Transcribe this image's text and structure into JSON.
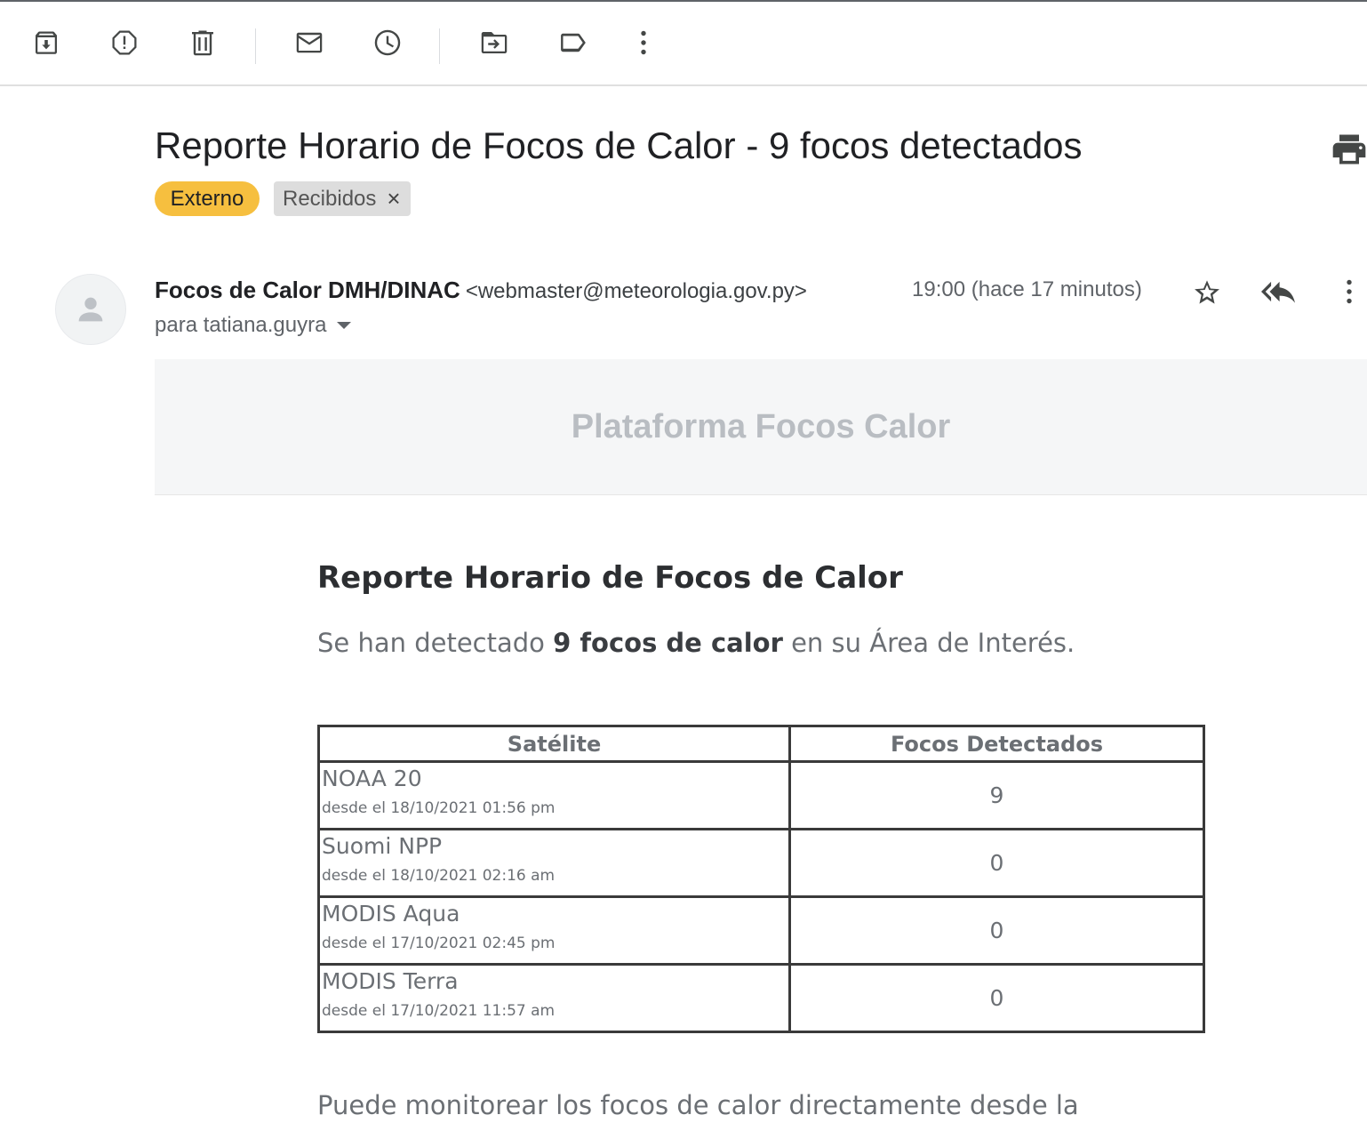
{
  "toolbar": {
    "icons": [
      "archive-icon",
      "report-spam-icon",
      "delete-icon",
      "mark-unread-icon",
      "snooze-icon",
      "move-to-icon",
      "label-icon",
      "more-vert-icon"
    ]
  },
  "subject": "Reporte Horario de Focos de Calor - 9 focos detectados",
  "labels": {
    "external": "Externo",
    "inbox": "Recibidos",
    "inbox_remove": "×"
  },
  "sender": {
    "name": "Focos de Calor DMH/DINAC",
    "email": "<webmaster@meteorologia.gov.py>",
    "to": "para tatiana.guyra",
    "time": "19:00 (hace 17 minutos)"
  },
  "email": {
    "banner": "Plataforma Focos Calor",
    "heading": "Reporte Horario de Focos de Calor",
    "lead_before": "Se han detectado ",
    "lead_bold": "9 focos de calor",
    "lead_after": " en su Área de Interés.",
    "table": {
      "headers": [
        "Satélite",
        "Focos Detectados"
      ],
      "rows": [
        {
          "satellite": "NOAA 20",
          "since": "desde el 18/10/2021 01:56 pm",
          "count": "9"
        },
        {
          "satellite": "Suomi NPP",
          "since": "desde el 18/10/2021 02:16 am",
          "count": "0"
        },
        {
          "satellite": "MODIS Aqua",
          "since": "desde el 17/10/2021 02:45 pm",
          "count": "0"
        },
        {
          "satellite": "MODIS Terra",
          "since": "desde el 17/10/2021 11:57 am",
          "count": "0"
        }
      ]
    },
    "footer": "Puede monitorear los focos de calor directamente desde la"
  }
}
